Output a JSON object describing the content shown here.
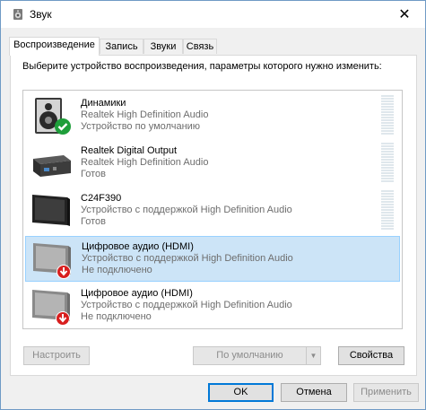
{
  "window": {
    "title": "Звук",
    "close_glyph": "✕"
  },
  "tabs": [
    {
      "label": "Воспроизведение",
      "active": true
    },
    {
      "label": "Запись",
      "active": false
    },
    {
      "label": "Звуки",
      "active": false
    },
    {
      "label": "Связь",
      "active": false
    }
  ],
  "panel": {
    "prompt": "Выберите устройство воспроизведения, параметры которого нужно изменить:"
  },
  "devices": [
    {
      "name": "Динамики",
      "description": "Realtek High Definition Audio",
      "status": "Устройство по умолчанию",
      "icon": "speaker-icon",
      "badge": "default-check-icon",
      "selected": false
    },
    {
      "name": "Realtek Digital Output",
      "description": "Realtek High Definition Audio",
      "status": "Готов",
      "icon": "digital-output-icon",
      "badge": "",
      "selected": false
    },
    {
      "name": "C24F390",
      "description": "Устройство с поддержкой High Definition Audio",
      "status": "Готов",
      "icon": "monitor-icon",
      "badge": "",
      "selected": false
    },
    {
      "name": "Цифровое аудио (HDMI)",
      "description": "Устройство с поддержкой High Definition Audio",
      "status": "Не подключено",
      "icon": "monitor-disconnected-icon",
      "badge": "unplugged-arrow-icon",
      "selected": true
    },
    {
      "name": "Цифровое аудио (HDMI)",
      "description": "Устройство с поддержкой High Definition Audio",
      "status": "Не подключено",
      "icon": "monitor-disconnected-icon",
      "badge": "unplugged-arrow-icon",
      "selected": false
    }
  ],
  "panel_buttons": {
    "configure": "Настроить",
    "set_default": "По умолчанию",
    "properties": "Свойства"
  },
  "dialog_buttons": {
    "ok": "OK",
    "cancel": "Отмена",
    "apply": "Применить"
  },
  "colors": {
    "selection_bg": "#cce4f7",
    "selection_border": "#99d1ff",
    "default_check": "#1e9e3a",
    "unplugged_arrow": "#d81e1e",
    "accent": "#0078d7"
  }
}
